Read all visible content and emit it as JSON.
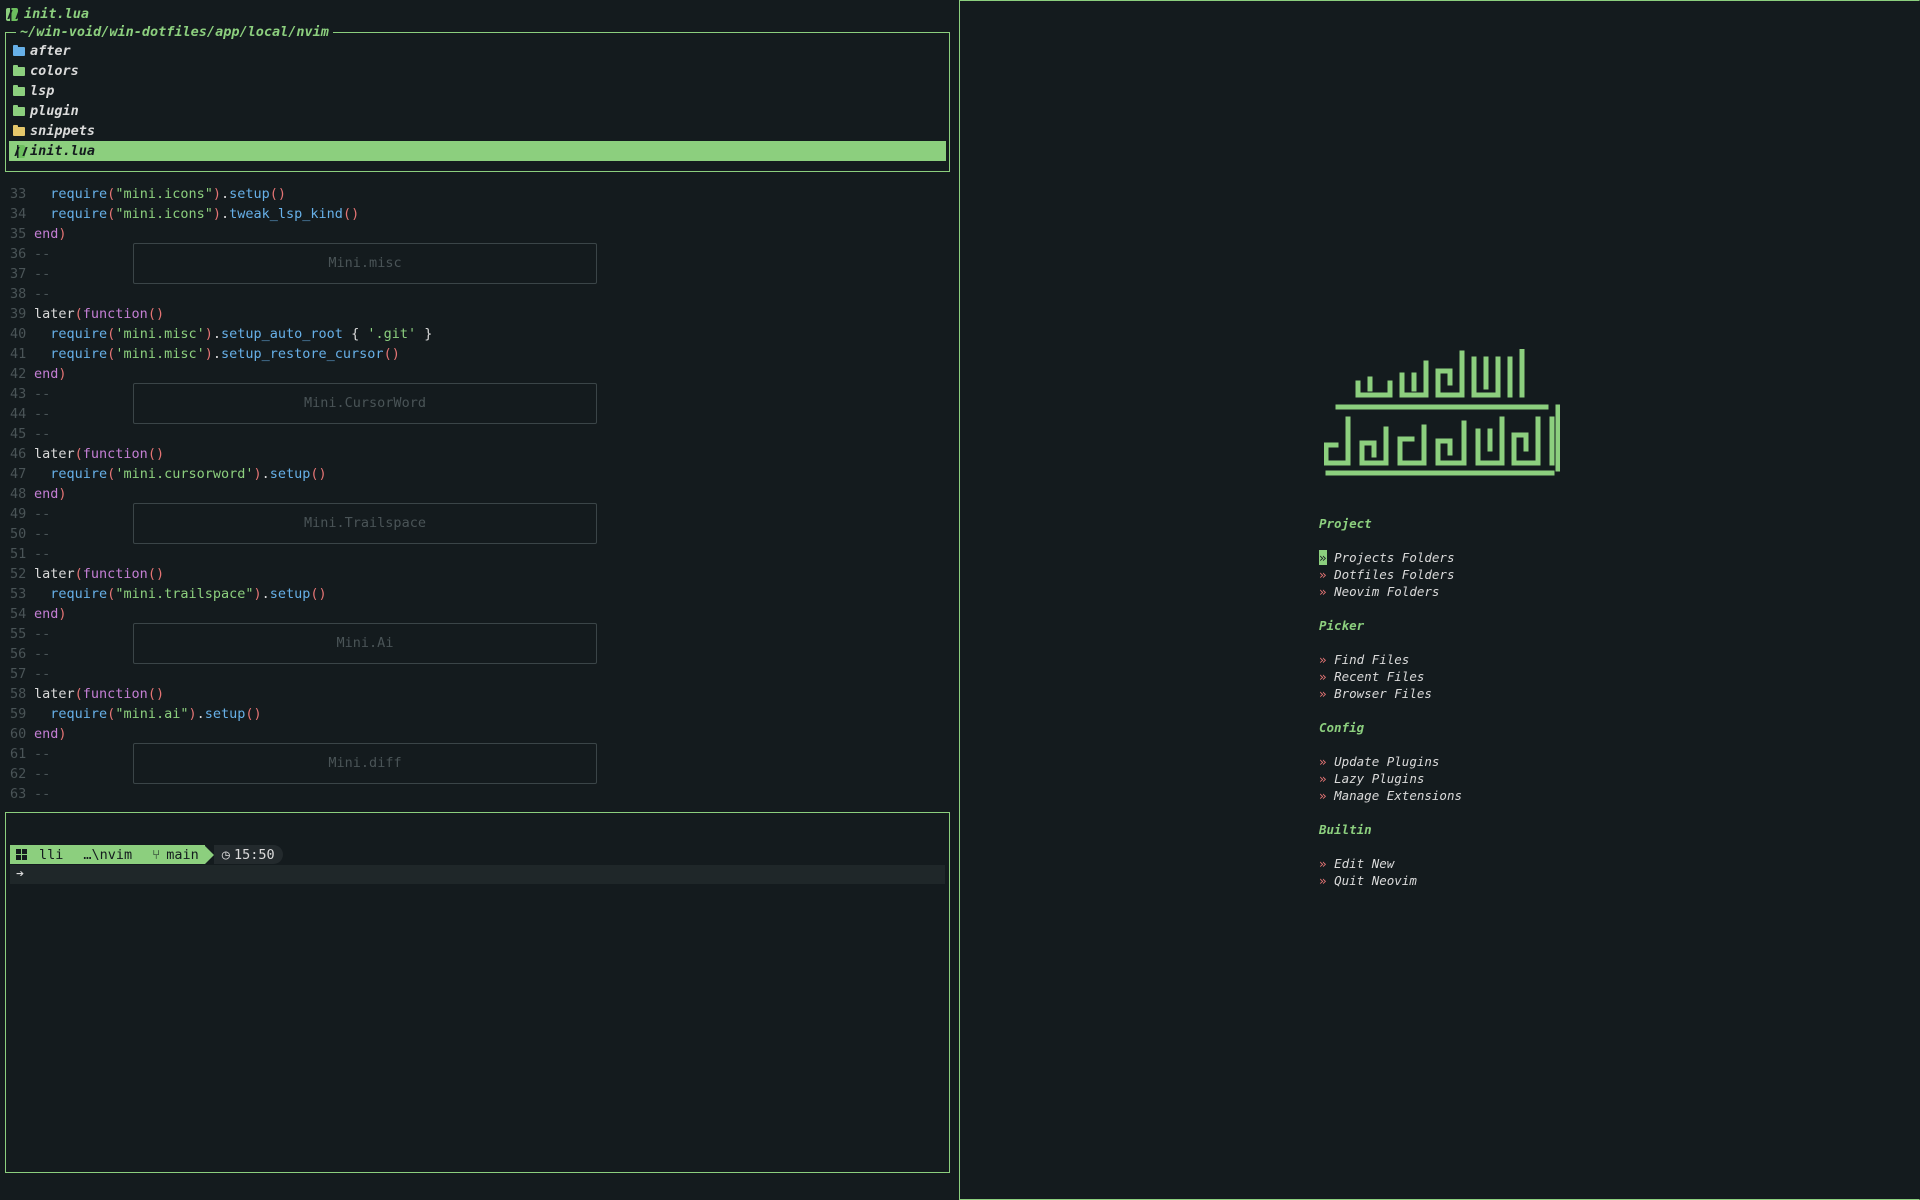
{
  "tabline": {
    "filename": "init.lua"
  },
  "explorer": {
    "path": "~/win-void/win-dotfiles/app/local/nvim",
    "items": [
      {
        "label": "after",
        "icon": "folder-icon",
        "color": "#67b0e8"
      },
      {
        "label": "colors",
        "icon": "folder-icon",
        "color": "#8ccf7e"
      },
      {
        "label": "lsp",
        "icon": "folder-icon",
        "color": "#8ccf7e"
      },
      {
        "label": "plugin",
        "icon": "folder-icon",
        "color": "#8ccf7e"
      },
      {
        "label": "snippets",
        "icon": "folder-icon",
        "color": "#e5c76b"
      },
      {
        "label": "init.lua",
        "icon": "neovim-icon",
        "selected": true
      }
    ]
  },
  "code": {
    "lines": [
      {
        "n": "33",
        "t": "  require(\"mini.icons\").setup()"
      },
      {
        "n": "34",
        "t": "  require(\"mini.icons\").tweak_lsp_kind()"
      },
      {
        "n": "35",
        "t": "end)"
      },
      {
        "n": "36",
        "t": "--"
      },
      {
        "n": "37",
        "t": "--"
      },
      {
        "n": "38",
        "t": "--"
      },
      {
        "n": "39",
        "t": "later(function()"
      },
      {
        "n": "40",
        "t": "  require('mini.misc').setup_auto_root { '.git' }"
      },
      {
        "n": "41",
        "t": "  require('mini.misc').setup_restore_cursor()"
      },
      {
        "n": "42",
        "t": "end)"
      },
      {
        "n": "43",
        "t": "--"
      },
      {
        "n": "44",
        "t": "--"
      },
      {
        "n": "45",
        "t": "--"
      },
      {
        "n": "46",
        "t": "later(function()"
      },
      {
        "n": "47",
        "t": "  require('mini.cursorword').setup()"
      },
      {
        "n": "48",
        "t": "end)"
      },
      {
        "n": "49",
        "t": "--"
      },
      {
        "n": "50",
        "t": "--"
      },
      {
        "n": "51",
        "t": "--"
      },
      {
        "n": "52",
        "t": "later(function()"
      },
      {
        "n": "53",
        "t": "  require(\"mini.trailspace\").setup()"
      },
      {
        "n": "54",
        "t": "end)"
      },
      {
        "n": "55",
        "t": "--"
      },
      {
        "n": "56",
        "t": "--"
      },
      {
        "n": "57",
        "t": "--"
      },
      {
        "n": "58",
        "t": "later(function()"
      },
      {
        "n": "59",
        "t": "  require(\"mini.ai\").setup()"
      },
      {
        "n": "60",
        "t": "end)"
      },
      {
        "n": "61",
        "t": "--"
      },
      {
        "n": "62",
        "t": "--"
      },
      {
        "n": "63",
        "t": "--"
      }
    ],
    "banners": [
      "Mini.misc",
      "Mini.CursorWord",
      "Mini.Trailspace",
      "Mini.Ai",
      "Mini.diff"
    ]
  },
  "terminal": {
    "user": "lli",
    "dir": "…\\nvim",
    "branch": "main",
    "time": "15:50",
    "input_glyph": "➔"
  },
  "dashboard": {
    "sections": [
      {
        "title": "Project",
        "items": [
          "Projects Folders",
          "Dotfiles Folders",
          "Neovim Folders"
        ]
      },
      {
        "title": "Picker",
        "items": [
          "Find Files",
          "Recent Files",
          "Browser Files"
        ]
      },
      {
        "title": "Config",
        "items": [
          "Update Plugins",
          "Lazy Plugins",
          "Manage Extensions"
        ]
      },
      {
        "title": "Builtin",
        "items": [
          "Edit New",
          "Quit Neovim"
        ]
      }
    ],
    "marker": "»",
    "accent": "#8ccf7e"
  }
}
